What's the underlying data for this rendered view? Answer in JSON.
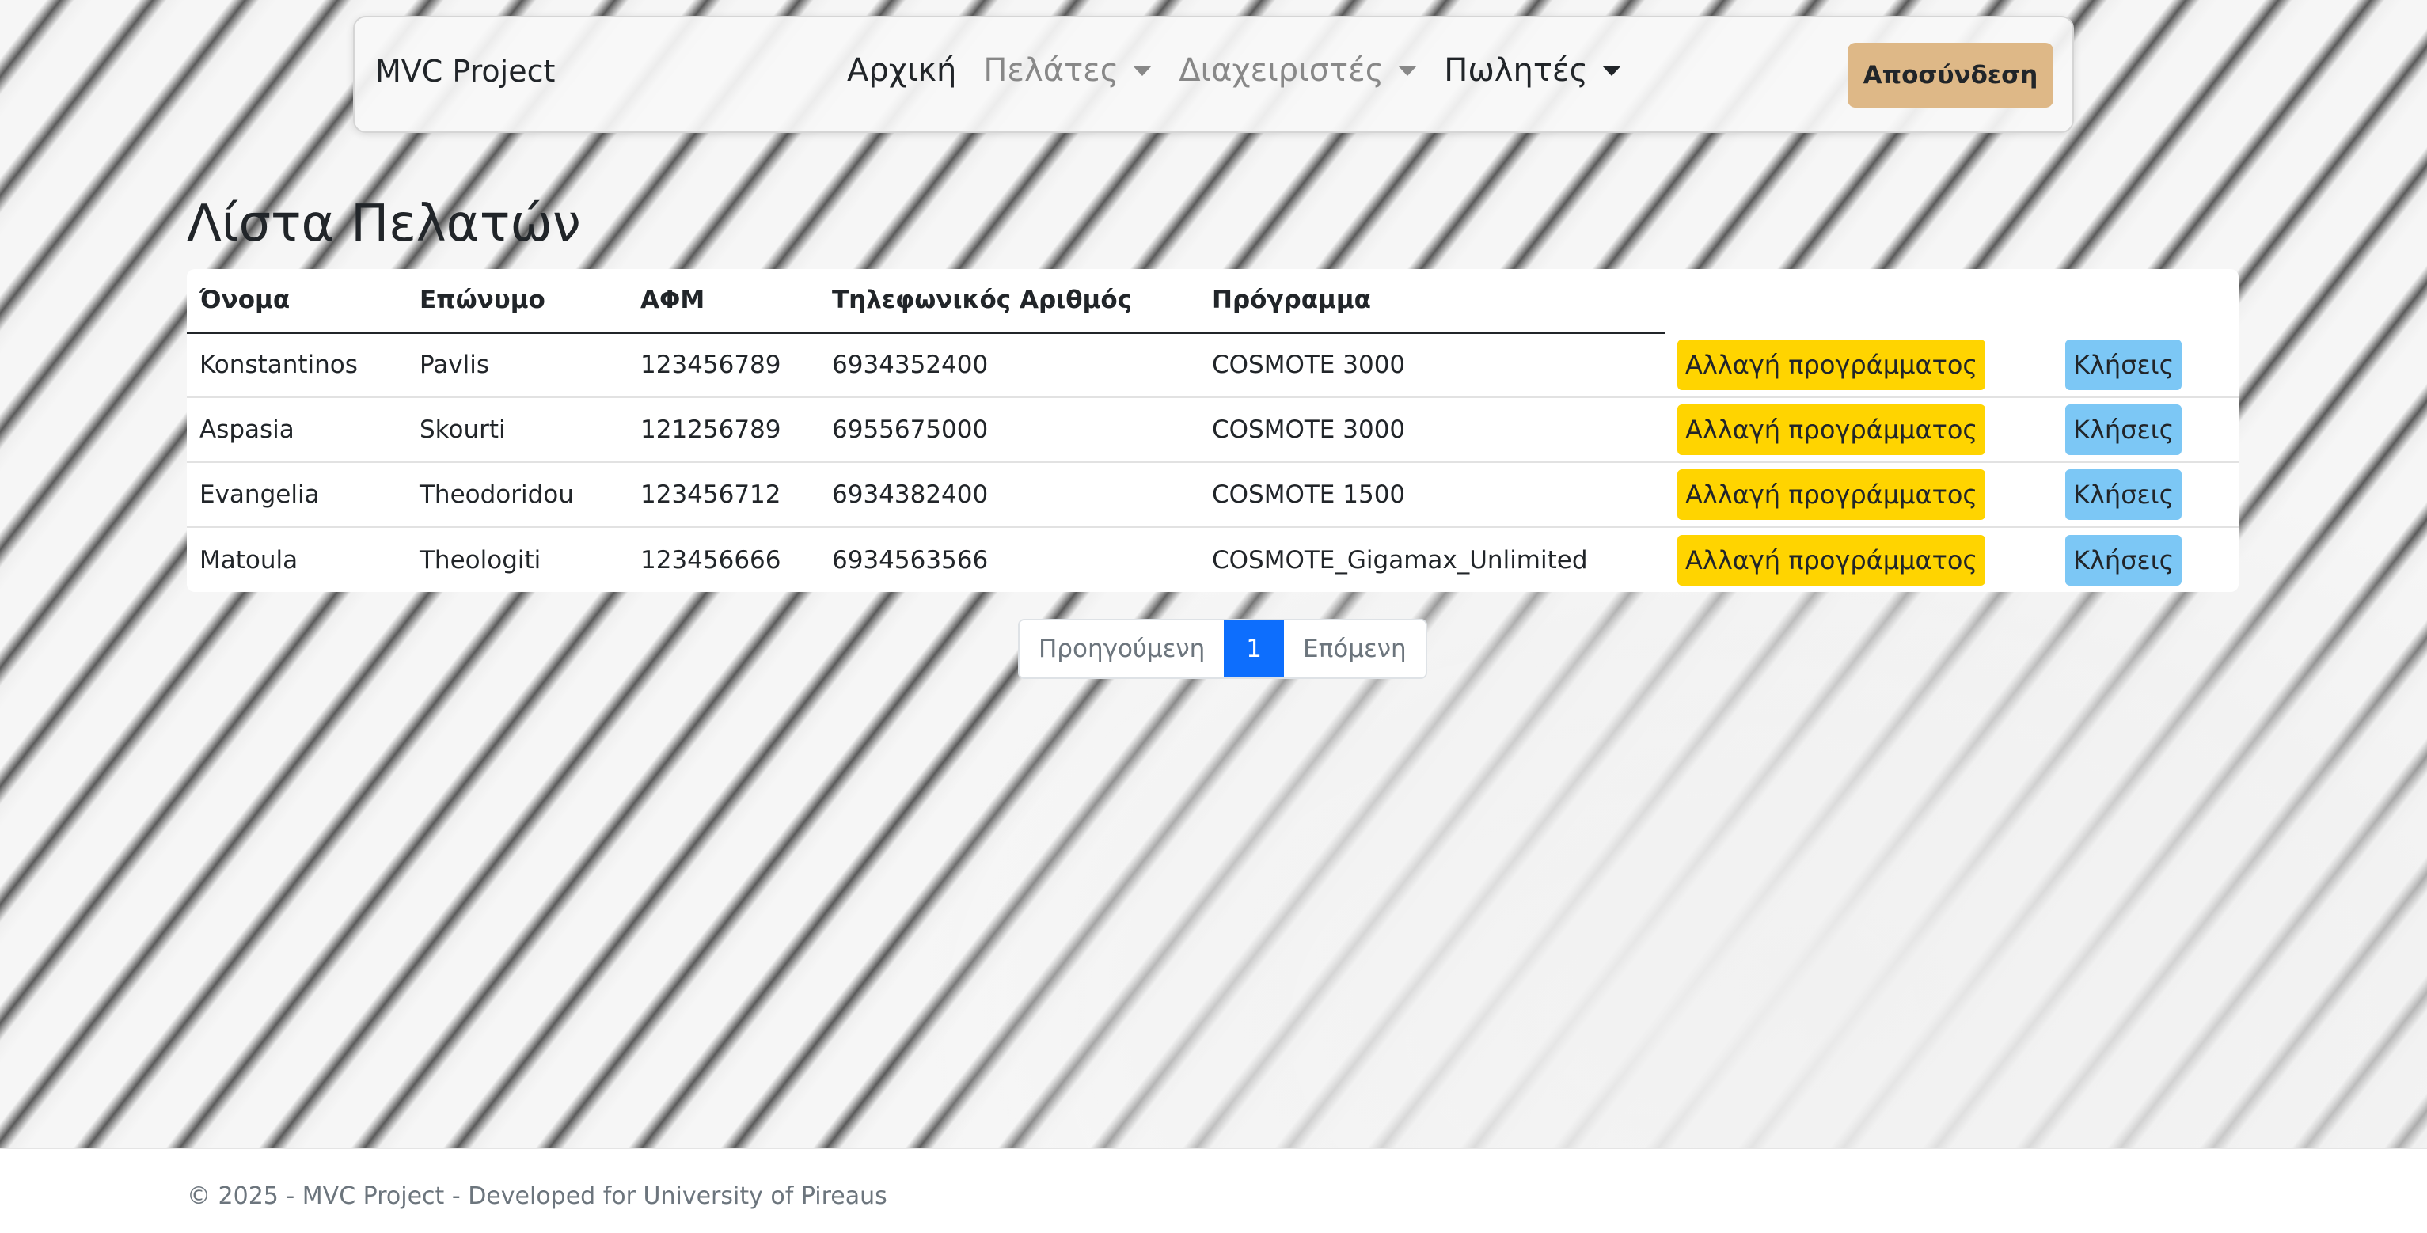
{
  "navbar": {
    "brand": "MVC Project",
    "items": [
      {
        "label": "Αρχική",
        "dropdown": false
      },
      {
        "label": "Πελάτες",
        "dropdown": true
      },
      {
        "label": "Διαχειριστές",
        "dropdown": true
      },
      {
        "label": "Πωλητές",
        "dropdown": true
      }
    ],
    "logout_label": "Αποσύνδεση",
    "logout_color": "#deb887"
  },
  "page": {
    "title": "Λίστα Πελατών"
  },
  "table": {
    "headers": [
      "Όνομα",
      "Επώνυμο",
      "ΑΦΜ",
      "Τηλεφωνικός Αριθμός",
      "Πρόγραμμα"
    ],
    "rows": [
      {
        "first": "Konstantinos",
        "last": "Pavlis",
        "afm": "123456789",
        "phone": "6934352400",
        "program": "COSMOTE 3000"
      },
      {
        "first": "Aspasia",
        "last": "Skourti",
        "afm": "121256789",
        "phone": "6955675000",
        "program": "COSMOTE 3000"
      },
      {
        "first": "Evangelia",
        "last": "Theodoridou",
        "afm": "123456712",
        "phone": "6934382400",
        "program": "COSMOTE 1500"
      },
      {
        "first": "Matoula",
        "last": "Theologiti",
        "afm": "123456666",
        "phone": "6934563566",
        "program": "COSMOTE_Gigamax_Unlimited"
      }
    ],
    "change_label": "Αλλαγή προγράμματος",
    "calls_label": "Κλήσεις",
    "change_color": "#ffd400",
    "calls_color": "#7cc7f5"
  },
  "pagination": {
    "prev": "Προηγούμενη",
    "current": "1",
    "next": "Επόμενη",
    "active_color": "#0d6efd"
  },
  "footer": {
    "text": "© 2025 - MVC Project - Developed for University of Pireaus"
  }
}
